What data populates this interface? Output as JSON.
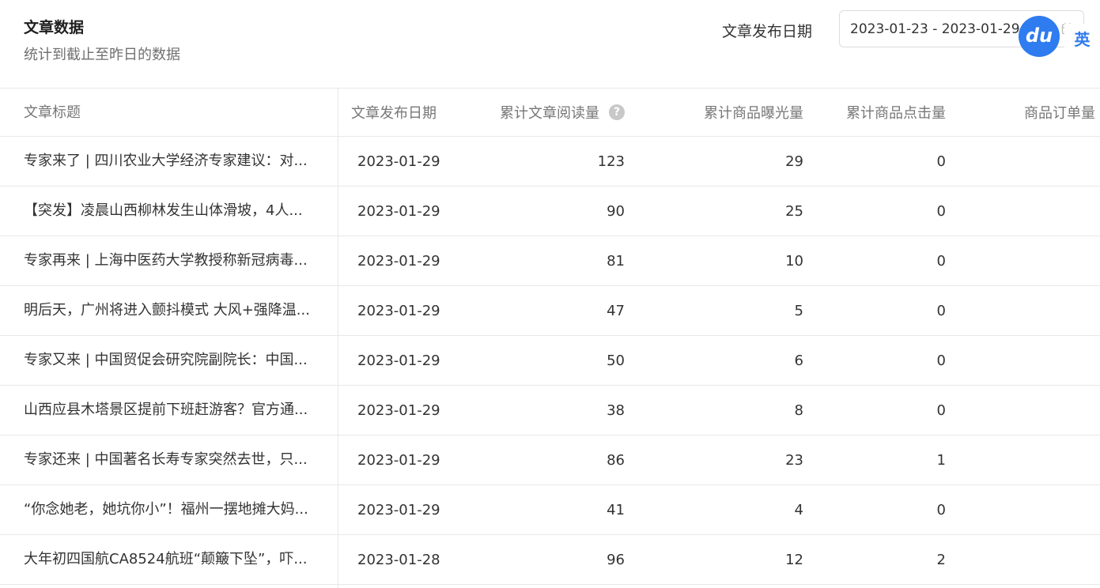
{
  "header": {
    "title": "文章数据",
    "subtitle": "统计到截止至昨日的数据",
    "date_label": "文章发布日期",
    "date_range": "2023-01-23 - 2023-01-29"
  },
  "overlay": {
    "du_badge": "du",
    "ying_badge": "英"
  },
  "table": {
    "columns": {
      "title": "文章标题",
      "date": "文章发布日期",
      "reads": "累计文章阅读量",
      "help": "?",
      "exposure": "累计商品曝光量",
      "clicks": "累计商品点击量",
      "orders": "商品订单量"
    },
    "rows": [
      {
        "title": "专家来了 | 四川农业大学经济专家建议：对...",
        "date": "2023-01-29",
        "reads": "123",
        "exposure": "29",
        "clicks": "0"
      },
      {
        "title": "【突发】凌晨山西柳林发生山体滑坡，4人...",
        "date": "2023-01-29",
        "reads": "90",
        "exposure": "25",
        "clicks": "0"
      },
      {
        "title": "专家再来 | 上海中医药大学教授称新冠病毒...",
        "date": "2023-01-29",
        "reads": "81",
        "exposure": "10",
        "clicks": "0"
      },
      {
        "title": "明后天，广州将进入颤抖模式 大风+强降温...",
        "date": "2023-01-29",
        "reads": "47",
        "exposure": "5",
        "clicks": "0"
      },
      {
        "title": "专家又来 | 中国贸促会研究院副院长：中国...",
        "date": "2023-01-29",
        "reads": "50",
        "exposure": "6",
        "clicks": "0"
      },
      {
        "title": "山西应县木塔景区提前下班赶游客？官方通...",
        "date": "2023-01-29",
        "reads": "38",
        "exposure": "8",
        "clicks": "0"
      },
      {
        "title": "专家还来 | 中国著名长寿专家突然去世，只...",
        "date": "2023-01-29",
        "reads": "86",
        "exposure": "23",
        "clicks": "1"
      },
      {
        "title": "“你念她老，她坑你小”！福州一摆地摊大妈...",
        "date": "2023-01-29",
        "reads": "41",
        "exposure": "4",
        "clicks": "0"
      },
      {
        "title": "大年初四国航CA8524航班“颠簸下坠”，吓...",
        "date": "2023-01-28",
        "reads": "96",
        "exposure": "12",
        "clicks": "2"
      }
    ]
  }
}
